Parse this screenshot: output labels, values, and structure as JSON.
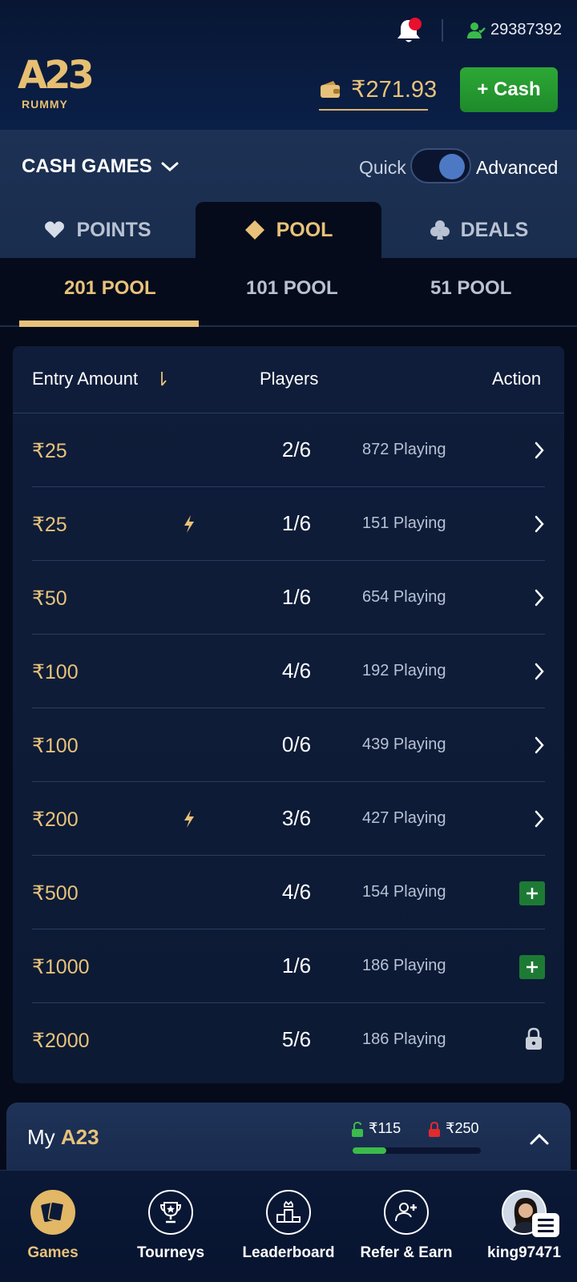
{
  "header": {
    "user_id": "29387392",
    "logo_text": "A23",
    "logo_sub": "RUMMY",
    "balance": "₹271.93",
    "cash_button": "+ Cash",
    "notification_dot_color": "#e8102d"
  },
  "lobby": {
    "section_title": "CASH GAMES",
    "toggle_left": "Quick",
    "toggle_right": "Advanced",
    "toggle_state": "Advanced",
    "game_tabs": [
      {
        "label": "POINTS",
        "icon": "heart-icon",
        "active": false
      },
      {
        "label": "POOL",
        "icon": "diamond-icon",
        "active": true
      },
      {
        "label": "DEALS",
        "icon": "club-icon",
        "active": false
      }
    ],
    "sub_tabs": [
      {
        "label": "201 POOL",
        "active": true
      },
      {
        "label": "101 POOL",
        "active": false
      },
      {
        "label": "51 POOL",
        "active": false
      }
    ]
  },
  "table": {
    "col_entry": "Entry Amount",
    "col_players": "Players",
    "col_action": "Action",
    "rows": [
      {
        "amount": "₹25",
        "bolt": false,
        "players": "2/6",
        "playing": "872 Playing",
        "action": "chevron"
      },
      {
        "amount": "₹25",
        "bolt": true,
        "players": "1/6",
        "playing": "151 Playing",
        "action": "chevron"
      },
      {
        "amount": "₹50",
        "bolt": false,
        "players": "1/6",
        "playing": "654 Playing",
        "action": "chevron"
      },
      {
        "amount": "₹100",
        "bolt": false,
        "players": "4/6",
        "playing": "192 Playing",
        "action": "chevron"
      },
      {
        "amount": "₹100",
        "bolt": false,
        "players": "0/6",
        "playing": "439 Playing",
        "action": "chevron"
      },
      {
        "amount": "₹200",
        "bolt": true,
        "players": "3/6",
        "playing": "427 Playing",
        "action": "chevron"
      },
      {
        "amount": "₹500",
        "bolt": false,
        "players": "4/6",
        "playing": "154 Playing",
        "action": "plus"
      },
      {
        "amount": "₹1000",
        "bolt": false,
        "players": "1/6",
        "playing": "186 Playing",
        "action": "plus"
      },
      {
        "amount": "₹2000",
        "bolt": false,
        "players": "5/6",
        "playing": "186 Playing",
        "action": "lock"
      }
    ]
  },
  "my_a23": {
    "title_prefix": "My",
    "title_brand": "A23",
    "unlocked": "₹115",
    "locked": "₹250",
    "progress_fraction": 0.26
  },
  "nav": [
    {
      "label": "Games",
      "icon": "cards-icon",
      "active": true
    },
    {
      "label": "Tourneys",
      "icon": "trophy-icon",
      "active": false
    },
    {
      "label": "Leaderboard",
      "icon": "podium-icon",
      "active": false
    },
    {
      "label": "Refer & Earn",
      "icon": "refer-icon",
      "active": false
    },
    {
      "label": "king97471",
      "icon": "avatar",
      "active": false
    }
  ]
}
